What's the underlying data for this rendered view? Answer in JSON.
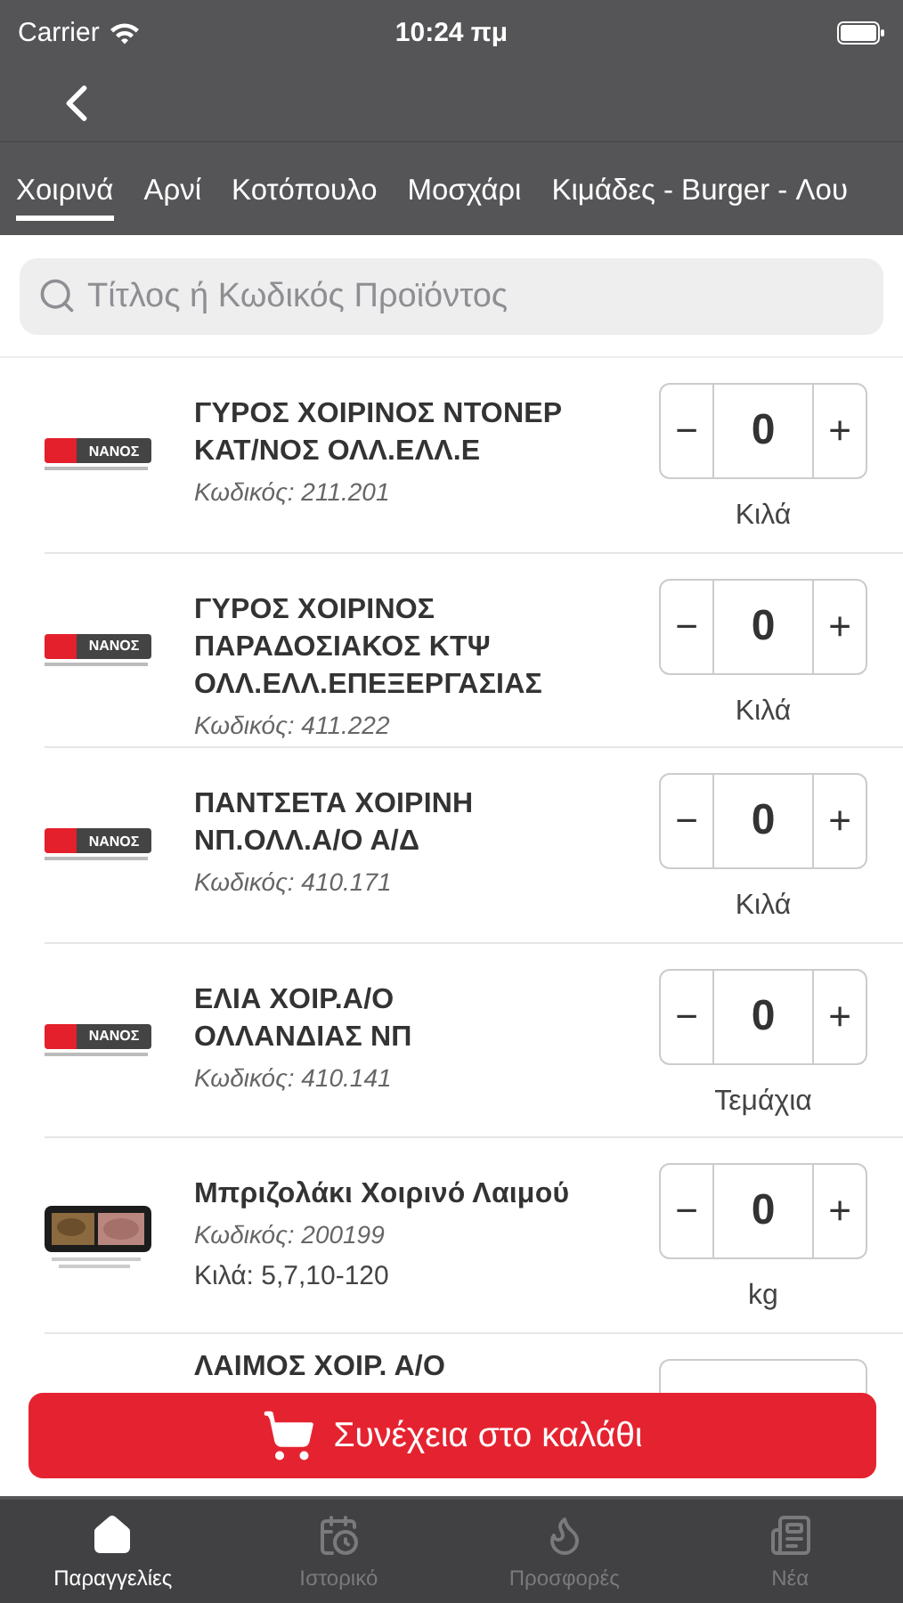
{
  "status_bar": {
    "carrier": "Carrier",
    "time": "10:24 πμ"
  },
  "tabs": [
    {
      "label": "Χοιρινά",
      "selected": true
    },
    {
      "label": "Αρνί",
      "selected": false
    },
    {
      "label": "Κοτόπουλο",
      "selected": false
    },
    {
      "label": "Μοσχάρι",
      "selected": false
    },
    {
      "label": "Κιμάδες - Burger - Λου",
      "selected": false
    }
  ],
  "search": {
    "placeholder": "Τίτλος ή Κωδικός Προϊόντος"
  },
  "products": [
    {
      "kind": "logo",
      "logo_text": "ΝΑΝΟΣ",
      "name_lines": [
        "ΓΥΡΟΣ ΧΟΙΡΙΝΟΣ ΝΤΟΝΕΡ",
        "ΚΑΤ/ΝΟΣ ΟΛΛ.ΕΛΛ.Ε"
      ],
      "code": "Κωδικός: 211.201",
      "minus": "−",
      "quantity": "0",
      "plus": "+",
      "unit": "Κιλά"
    },
    {
      "kind": "logo",
      "logo_text": "ΝΑΝΟΣ",
      "name_lines": [
        "ΓΥΡΟΣ ΧΟΙΡΙΝΟΣ",
        "ΠΑΡΑΔΟΣΙΑΚΟΣ ΚΤΨ",
        "ΟΛΛ.ΕΛΛ.ΕΠΕΞΕΡΓΑΣΙΑΣ"
      ],
      "code": "Κωδικός: 411.222",
      "minus": "−",
      "quantity": "0",
      "plus": "+",
      "unit": "Κιλά"
    },
    {
      "kind": "logo",
      "logo_text": "ΝΑΝΟΣ",
      "name_lines": [
        "ΠΑΝΤΣΕΤΑ ΧΟΙΡΙΝΗ",
        "ΝΠ.ΟΛΛ.Α/Ο Α/Δ"
      ],
      "code": "Κωδικός: 410.171",
      "minus": "−",
      "quantity": "0",
      "plus": "+",
      "unit": "Κιλά"
    },
    {
      "kind": "logo",
      "logo_text": "ΝΑΝΟΣ",
      "name_lines": [
        "ΕΛΙΑ ΧΟΙΡ.Α/Ο",
        "ΟΛΛΑΝΔΙΑΣ ΝΠ"
      ],
      "code": "Κωδικός: 410.141",
      "minus": "−",
      "quantity": "0",
      "plus": "+",
      "unit": "Τεμάχια"
    },
    {
      "name_lines": [
        "Μπριζολάκι Χοιρινό Λαιμού"
      ],
      "code": "Κωδικός: 200199",
      "note": "Κιλά: 5,7,10-120",
      "minus": "−",
      "quantity": "0",
      "plus": "+",
      "unit": "kg"
    },
    {
      "kind": "partial",
      "name_lines": [
        "ΛΑΙΜΟΣ ΧΟΙΡ. Α/Ο"
      ]
    }
  ],
  "cart_button": {
    "label": "Συνέχεια στο καλάθι"
  },
  "bottom_nav": [
    {
      "label": "Παραγγελίες",
      "kind": "home",
      "selected": true
    },
    {
      "label": "Ιστορικό",
      "kind": "history",
      "selected": false
    },
    {
      "label": "Προσφορές",
      "kind": "offers",
      "selected": false
    },
    {
      "label": "Νέα",
      "kind": "news",
      "selected": false
    }
  ]
}
